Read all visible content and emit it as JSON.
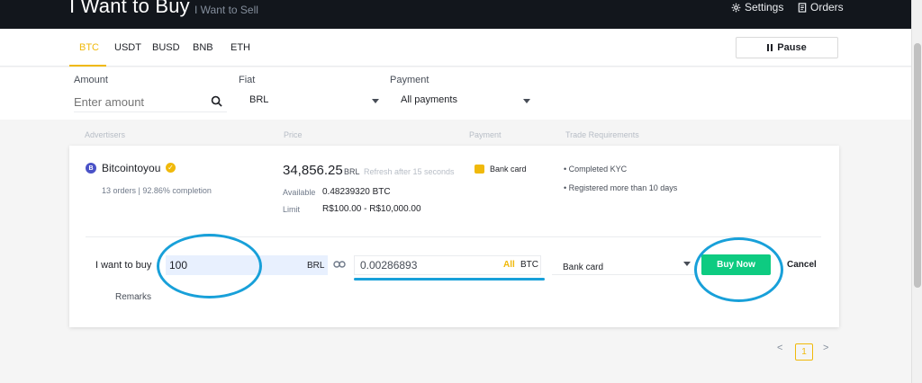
{
  "header": {
    "title": "I Want to Buy",
    "sell_tab": "I Want to Sell",
    "settings_label": "Settings",
    "orders_label": "Orders"
  },
  "tabs": [
    {
      "label": "BTC",
      "active": true
    },
    {
      "label": "USDT"
    },
    {
      "label": "BUSD"
    },
    {
      "label": "BNB"
    },
    {
      "label": "ETH"
    }
  ],
  "pause_label": "Pause",
  "filters": {
    "amount_label": "Amount",
    "amount_placeholder": "Enter amount",
    "fiat_label": "Fiat",
    "fiat_value": "BRL",
    "payment_label": "Payment",
    "payment_value": "All payments"
  },
  "columns": [
    "Advertisers",
    "Price",
    "Payment",
    "Trade Requirements"
  ],
  "ad": {
    "icon_letter": "B",
    "advertiser": "Bitcointoyou",
    "stats": "13 orders  |  92.86% completion",
    "price": "34,856.25",
    "price_currency": "BRL",
    "refresh": "Refresh after 15 seconds",
    "available_label": "Available",
    "available_value": "0.48239320 BTC",
    "limit_label": "Limit",
    "limit_value": "R$100.00 - R$10,000.00",
    "payment_method": "Bank card",
    "requirements": [
      "• Completed KYC",
      "• Registered more than 10 days"
    ]
  },
  "order": {
    "buy_label": "I want to buy",
    "buy_value": "100",
    "buy_unit": "BRL",
    "receive_value": "0.00286893",
    "all_label": "All",
    "receive_unit": "BTC",
    "method_value": "Bank card",
    "buy_now_label": "Buy Now",
    "cancel_label": "Cancel",
    "remarks_label": "Remarks"
  },
  "pagination": {
    "prev": "<",
    "page": "1",
    "next": ">"
  },
  "colors": {
    "accent": "#f0b90b",
    "buy": "#0ecb81",
    "annotation": "#18a0d9",
    "header_bg": "#12161c"
  }
}
